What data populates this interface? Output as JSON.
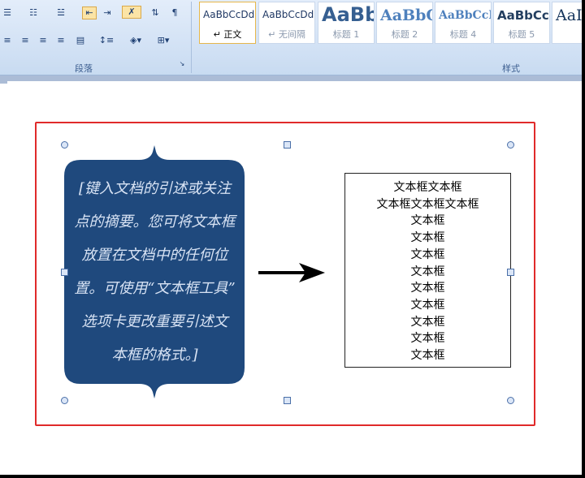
{
  "ribbon": {
    "paragraph_group_title": "段落",
    "styles_group_title": "样式",
    "styles": [
      {
        "sample": "AaBbCcDd",
        "name": "↵ 正文",
        "selected": true
      },
      {
        "sample": "AaBbCcDd",
        "name": "↵ 无间隔"
      },
      {
        "sample": "AaBb",
        "name": "标题 1"
      },
      {
        "sample": "AaBbC",
        "name": "标题 2"
      },
      {
        "sample": "AaBbCcI",
        "name": "标题 4"
      },
      {
        "sample": "AaBbCc",
        "name": "标题 5"
      },
      {
        "sample": "AaI",
        "name": ""
      }
    ]
  },
  "document": {
    "pull_quote_lines": [
      "[键入文档的引述或关注",
      "点的摘要。您可将文本框",
      "放置在文档中的任何位",
      "置。可使用“文本框工具”",
      "选项卡更改重要引述文",
      "本框的格式。]"
    ],
    "text_box_lines": [
      "文本框文本框",
      "文本框文本框文本框",
      "文本框",
      "文本框",
      "文本框",
      "文本框",
      "文本框",
      "文本框",
      "文本框",
      "文本框",
      "文本框"
    ]
  },
  "colors": {
    "quote_fill": "#1f497d",
    "selection_border": "#e02a2a",
    "arrow": "#000000"
  }
}
